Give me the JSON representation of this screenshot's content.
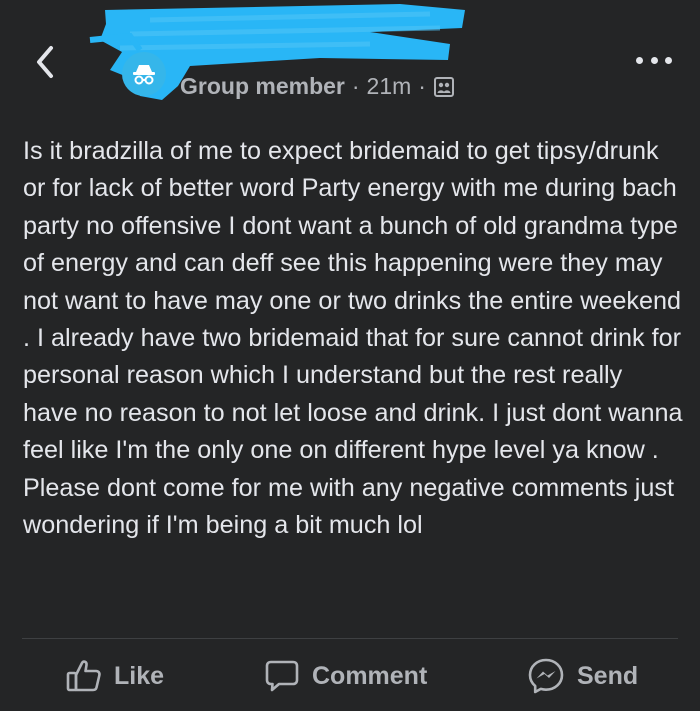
{
  "post": {
    "author_role": "Group member",
    "separator": "·",
    "time": "21m",
    "body": "Is  it bradzilla of me to expect bridemaid to get tipsy/drunk or for lack of better word Party energy with me during bach party no offensive I dont want a bunch of old grandma type of energy and can deff see this happening were they may not want to have may one or two drinks  the entire weekend . I already have two bridemaid that for sure cannot drink for personal reason which I understand but the rest really have no reason to not let loose and drink. I just dont wanna feel like I'm the only one on different hype level ya know . Please dont come for me with any negative comments  just wondering if I'm being a bit much lol"
  },
  "actions": {
    "like_label": "Like",
    "comment_label": "Comment",
    "send_label": "Send"
  },
  "icons": {
    "back": "chevron-left-icon",
    "more": "more-horizontal-icon",
    "privacy": "group-privacy-icon",
    "avatar": "anonymous-member-icon",
    "like": "thumbs-up-icon",
    "comment": "comment-bubble-icon",
    "send": "messenger-icon"
  },
  "colors": {
    "background": "#242526",
    "text": "#e4e6eb",
    "secondary_text": "#b0b3b8",
    "redaction": "#29b6f6",
    "avatar": "#35b6ea"
  }
}
